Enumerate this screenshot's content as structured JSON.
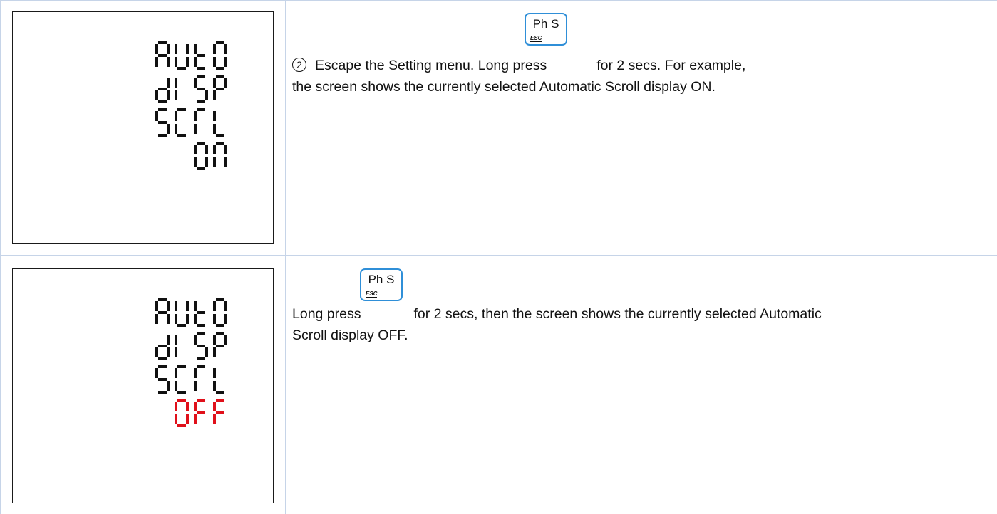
{
  "rows": [
    {
      "lcd_lines": [
        "AUtO",
        "dISP",
        "SCRL",
        "ON"
      ],
      "step_marker": "2",
      "text_before_key": "Escape the Setting menu. Long press",
      "text_after_key": "for 2 secs. For example,",
      "text_line2": "the screen shows the currently selected Automatic Scroll display ON.",
      "key": {
        "label": "Ph S",
        "sub": "ESC"
      }
    },
    {
      "lcd_lines": [
        "AUtO",
        "dISP",
        "SCRL",
        "OFF"
      ],
      "text_before_key": "Long press",
      "text_after_key": "for 2 secs, then the screen shows the currently selected Automatic",
      "text_line2": "Scroll display OFF.",
      "key": {
        "label": "Ph S",
        "sub": "ESC"
      }
    }
  ],
  "colors": {
    "lcd_segment": "#111111",
    "lcd_highlight": "#e0101a",
    "key_border": "#2f8fd8",
    "table_rule": "#c6d4e8"
  }
}
